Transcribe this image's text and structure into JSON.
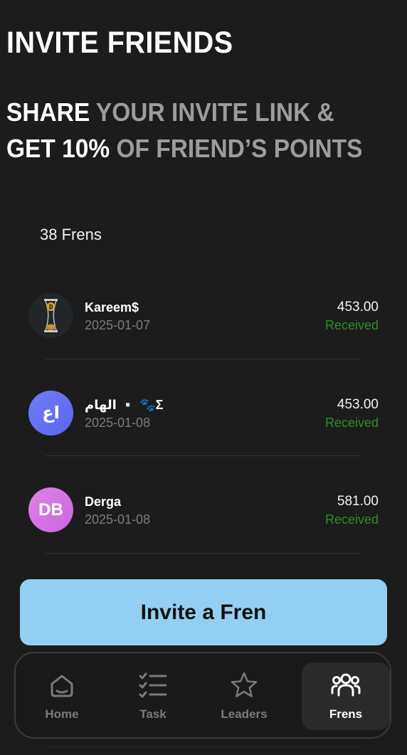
{
  "header": {
    "title": "INVITE FRIENDS",
    "subtitle_line1_white": "SHARE",
    "subtitle_line1_gray": "YOUR INVITE LINK &",
    "subtitle_line2_white": "GET 10%",
    "subtitle_line2_gray": "OF FRIEND’S POINTS"
  },
  "frens_count": "38 Frens",
  "friends": [
    {
      "initials": "",
      "name": "Kareem$",
      "date": "2025-01-07",
      "amount": "453.00",
      "status": "Received",
      "avatar_type": "photo"
    },
    {
      "initials": "اع",
      "name": "الهام ▫️ 🐾Σ",
      "date": "2025-01-08",
      "amount": "453.00",
      "status": "Received",
      "avatar_type": "blue"
    },
    {
      "initials": "DB",
      "name": "Derga",
      "date": "2025-01-08",
      "amount": "581.00",
      "status": "Received",
      "avatar_type": "pink"
    }
  ],
  "invite_button": "Invite a Fren",
  "nav": {
    "home": "Home",
    "task": "Task",
    "leaders": "Leaders",
    "frens": "Frens",
    "active": "frens"
  },
  "colors": {
    "background": "#1c1c1c",
    "accent_button": "#93cff2",
    "status_green": "#2e8b2e",
    "subtitle_gray": "#9a9ca0"
  },
  "icons": [
    "home-icon",
    "task-list-icon",
    "star-icon",
    "friends-group-icon"
  ]
}
